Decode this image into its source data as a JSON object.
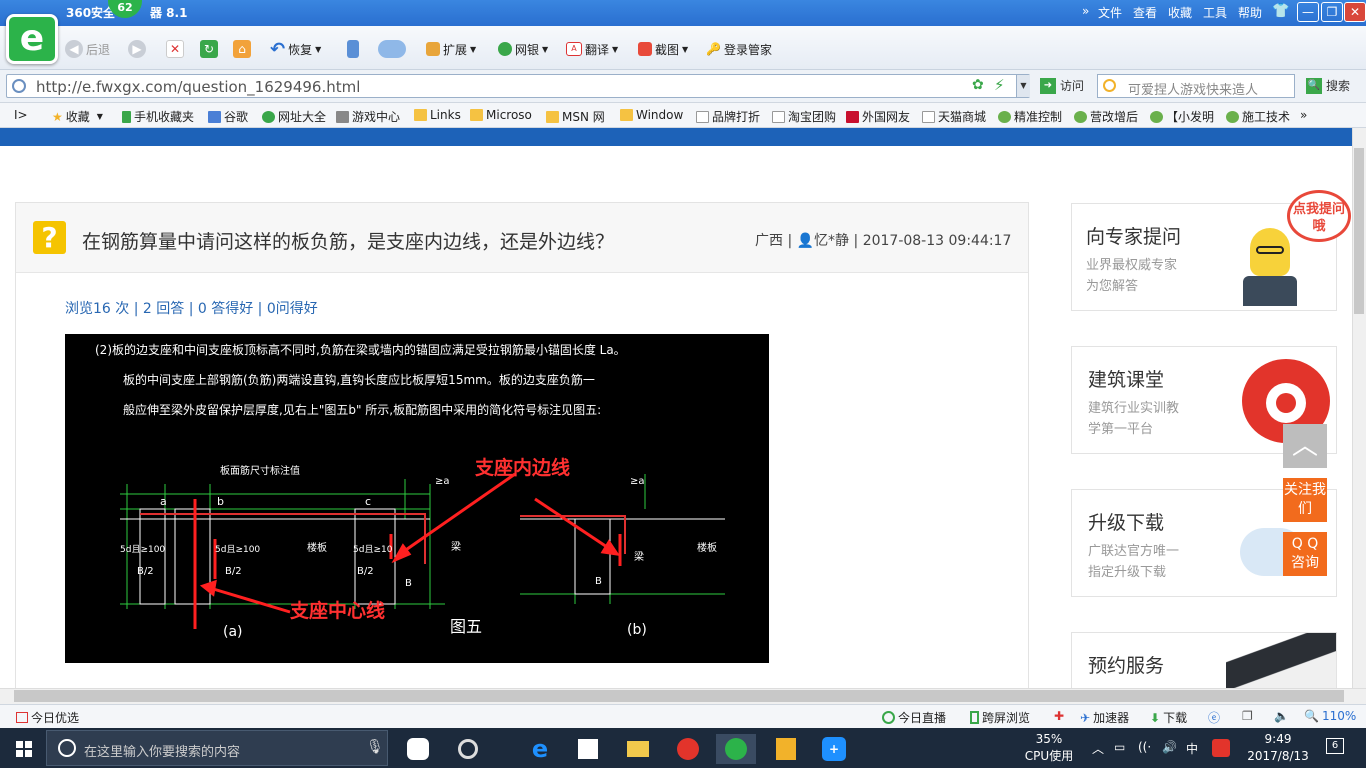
{
  "browser": {
    "name": "360安全浏览器 8.1",
    "title_prefix": "360安全",
    "title_suffix": "器 8.1",
    "badge": "62",
    "menu": [
      "文件",
      "查看",
      "收藏",
      "工具",
      "帮助"
    ],
    "toolbar": {
      "back": "后退",
      "restore": "恢复",
      "expand": "扩展",
      "bank": "网银",
      "translate": "翻译",
      "screenshot": "截图",
      "login": "登录管家"
    },
    "url": "http://e.fwxgx.com/question_1629496.html",
    "visit": "访问",
    "search_placeholder": "可爱捏人游戏快来造人",
    "search_button": "搜索",
    "bookmarks": [
      "收藏",
      "手机收藏夹",
      "谷歌",
      "网址大全",
      "游戏中心",
      "Links",
      "Microso",
      "MSN 网",
      "Window",
      "品牌打折",
      "淘宝团购",
      "外国网友",
      "天猫商城",
      "精准控制",
      "营改增后",
      "【小发明",
      "施工技术"
    ]
  },
  "question": {
    "title": "在钢筋算量中请问这样的板负筋，是支座内边线，还是外边线？",
    "region": "广西",
    "user": "忆*静",
    "datetime": "2017-08-13 09:44:17",
    "stats": "浏览16 次 | 2 回答 | 0 答得好 | 0问得好"
  },
  "cad": {
    "line1": "(2)板的边支座和中间支座板顶标高不同时,负筋在梁或墙内的锚固应满足受拉钢筋最小锚固长度 La。",
    "line2": "板的中间支座上部钢筋(负筋)两端设直钩,直钩长度应比板厚短15mm。板的边支座负筋一",
    "line3": "般应伸至梁外皮留保护层厚度,见右上\"图五b\" 所示,板配筋图中采用的简化符号标注见图五:",
    "dim_note": "板面筋尺寸标注值",
    "annot_inner": "支座内边线",
    "annot_center": "支座中心线",
    "fig": "图五",
    "fig_a": "(a)",
    "fig_b": "(b)",
    "slab": "楼板",
    "beam": "梁",
    "small_labels": [
      "a",
      "b",
      "c",
      "≥a",
      "B",
      "B/2",
      "5d且≥100",
      "5d且≥10",
      "d"
    ]
  },
  "sidebar": [
    {
      "title": "向专家提问",
      "sub1": "业界最权威专家",
      "sub2": "为您解答",
      "bubble": "点我提问哦"
    },
    {
      "title": "建筑课堂",
      "sub1": "建筑行业实训教",
      "sub2": "学第一平台"
    },
    {
      "title": "升级下载",
      "sub1": "广联达官方唯一",
      "sub2": "指定升级下载"
    },
    {
      "title": "预约服务"
    }
  ],
  "float_buttons": {
    "follow": "关注我们",
    "qq": "Q Q 咨询"
  },
  "statusbar": {
    "left": "今日优选",
    "live": "今日直播",
    "cross": "跨屏浏览",
    "accel": "加速器",
    "download": "下载",
    "zoom": "110%"
  },
  "taskbar": {
    "search": "在这里输入你要搜索的内容",
    "cpu": "35%",
    "cpu_label": "CPU使用",
    "ime": "中",
    "time": "9:49",
    "date": "2017/8/13",
    "notif": "6"
  },
  "colors": {
    "accent_blue": "#1d62b8",
    "brand_green": "#2cb34a",
    "question_yellow": "#f5c400",
    "float_orange": "#f26b1d"
  }
}
